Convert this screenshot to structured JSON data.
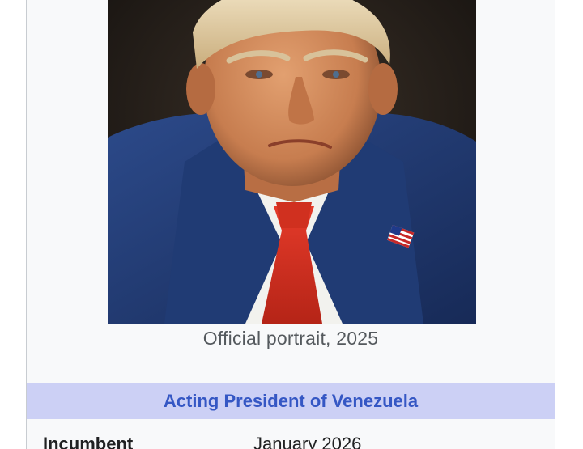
{
  "infobox": {
    "portrait_caption": "Official portrait, 2025",
    "section_header": "Acting President of Venezuela",
    "rows": [
      {
        "label": "Incumbent",
        "value": "January 2026"
      }
    ]
  },
  "colors": {
    "infobox_background": "#f8f9fa",
    "header_background": "#ccd0f5",
    "header_text": "#3557c4",
    "caption_text": "#54595d"
  }
}
